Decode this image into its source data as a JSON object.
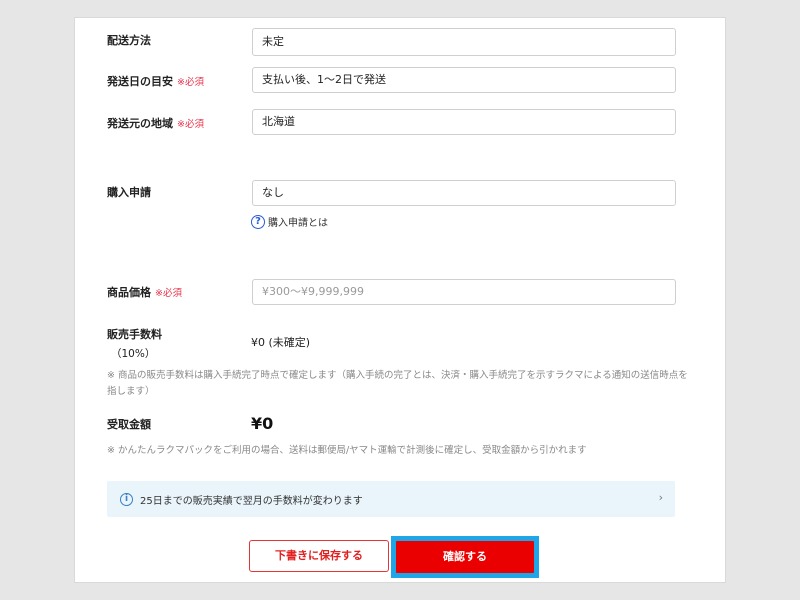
{
  "shipping_method": {
    "label": "配送方法",
    "value": "未定"
  },
  "shipping_days": {
    "label": "発送日の目安",
    "required": "※必須",
    "value": "支払い後、1〜2日で発送"
  },
  "shipping_origin": {
    "label": "発送元の地域",
    "required": "※必須",
    "value": "北海道"
  },
  "purchase_request": {
    "label": "購入申請",
    "value": "なし",
    "help_icon": "question-circle-icon",
    "help_text": "購入申請とは"
  },
  "price": {
    "label": "商品価格",
    "required": "※必須",
    "placeholder": "¥300〜¥9,999,999"
  },
  "fee": {
    "label": "販売手数料",
    "rate": "（10%）",
    "value": "¥0 (未確定)",
    "note": "※ 商品の販売手数料は購入手続完了時点で確定します（購入手続の完了とは、決済・購入手続完了を示すラクマによる通知の送信時点を指します）"
  },
  "receive": {
    "label": "受取金額",
    "value": "¥0",
    "note": "※ かんたんラクマパックをご利用の場合、送料は郵便局/ヤマト運輸で計測後に確定し、受取金額から引かれます"
  },
  "info_bar": {
    "icon": "info-circle-icon",
    "text": "25日までの販売実績で翌月の手数料が変わります",
    "chevron": "›"
  },
  "buttons": {
    "draft": "下書きに保存する",
    "confirm": "確認する"
  },
  "colors": {
    "required": "#e8334a",
    "confirm": "#ea0000",
    "highlight": "#20a6e6",
    "info_bg": "#e9f5fb"
  }
}
